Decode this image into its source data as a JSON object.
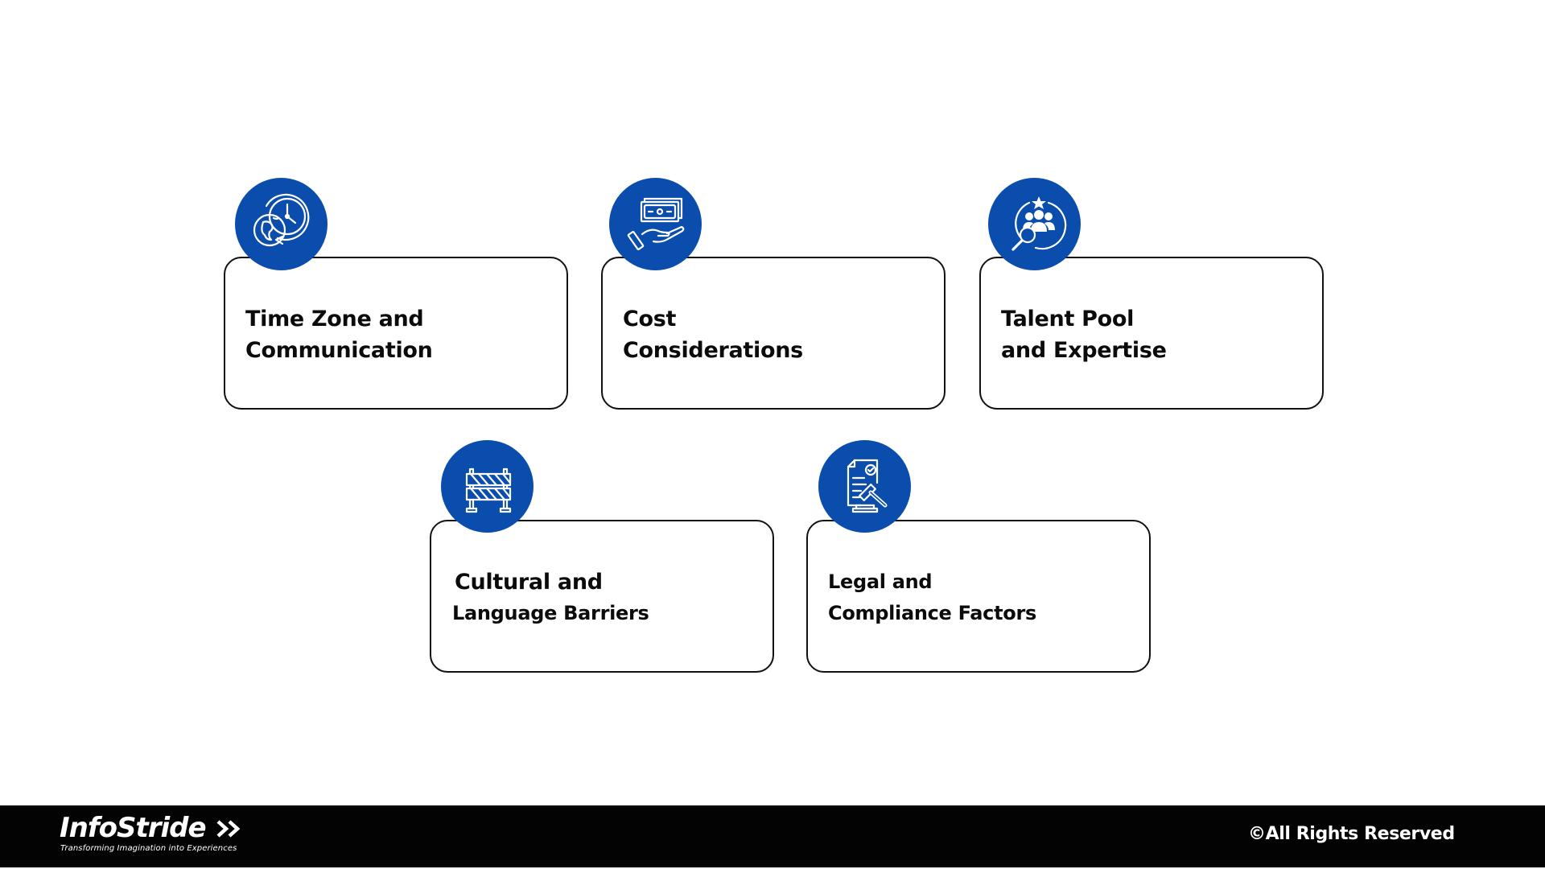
{
  "colors": {
    "accent": "#0a4dad",
    "card_border": "#111111",
    "footer_bg": "#030303",
    "text": "#0b0b0b"
  },
  "cards": [
    {
      "icon": "globe-clock-icon",
      "lines": [
        "Time Zone and",
        "Communication"
      ]
    },
    {
      "icon": "money-hand-icon",
      "lines": [
        "Cost",
        "Considerations"
      ]
    },
    {
      "icon": "talent-search-icon",
      "lines": [
        "Talent Pool",
        "and Expertise"
      ]
    },
    {
      "icon": "barrier-icon",
      "lines": [
        "Cultural and",
        "Language Barriers"
      ]
    },
    {
      "icon": "legal-gavel-icon",
      "lines": [
        "Legal and",
        "Compliance Factors"
      ]
    }
  ],
  "footer": {
    "brand": "InfoStride",
    "tagline": "Transforming Imagination into Experiences",
    "logo_icon": "double-chevron-right-icon",
    "rights": "©All Rights Reserved"
  }
}
